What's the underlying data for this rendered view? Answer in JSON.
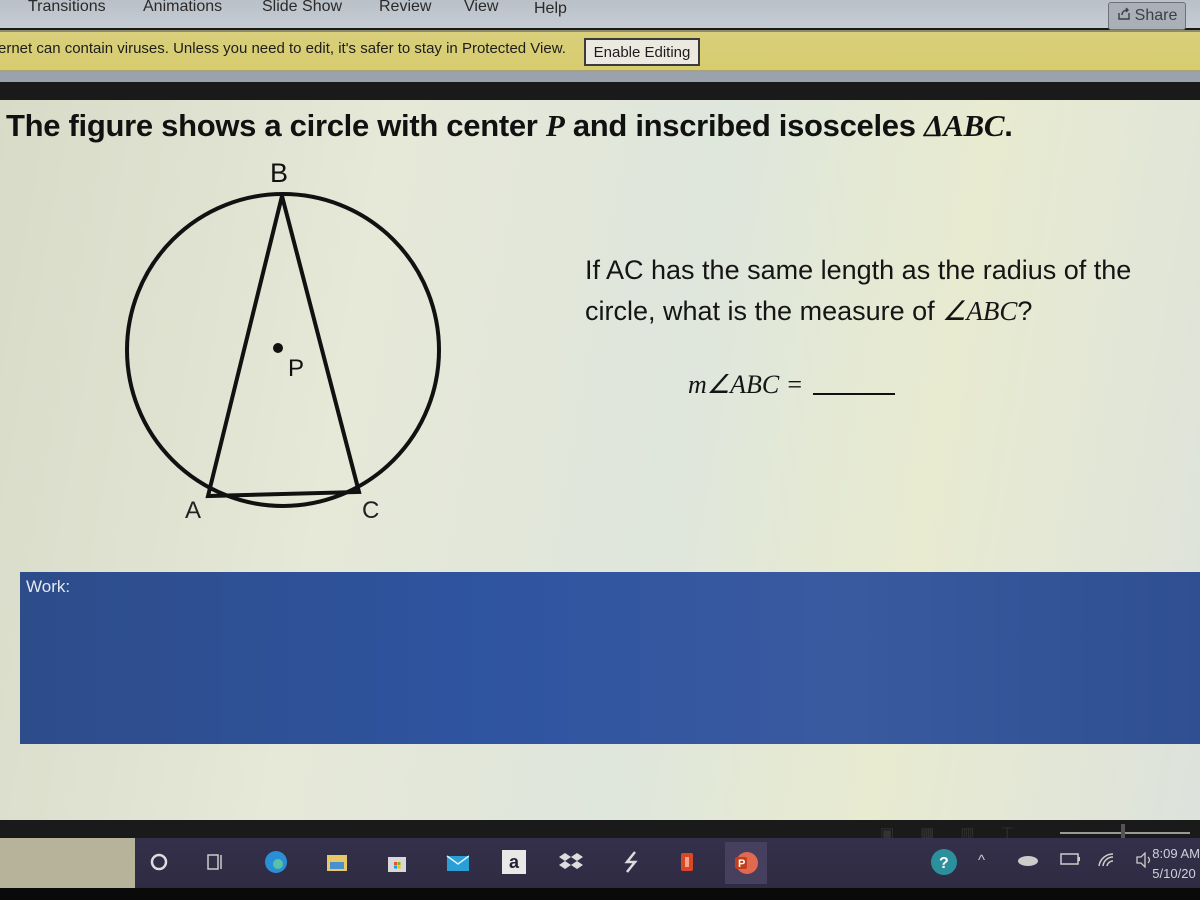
{
  "ribbon": {
    "tabs": [
      "Transitions",
      "Animations",
      "Slide Show",
      "Review",
      "View",
      "Help"
    ],
    "share_label": "Share",
    "share_icon": "share-icon"
  },
  "protected_view": {
    "message": "ernet can contain viruses. Unless you need to edit, it's safer to stay in Protected View.",
    "enable_button": "Enable Editing"
  },
  "slide": {
    "title_prefix": "The figure shows a circle with center ",
    "title_var": "P",
    "title_mid": " and inscribed isosceles ",
    "title_triangle": "ΔABC",
    "title_end": ".",
    "figure": {
      "labels": {
        "A": "A",
        "B": "B",
        "C": "C",
        "P": "P"
      }
    },
    "question_line1": "If AC has the same length as the radius of the",
    "question_line2_prefix": "circle, what is the measure of ",
    "question_angle": "∠ABC",
    "question_end": "?",
    "answer_label": "m∠ABC =",
    "work_label": "Work:"
  },
  "status_bar": {
    "view_icons": [
      "normal-view-icon",
      "slide-sorter-icon",
      "reading-view-icon",
      "slide-show-icon"
    ],
    "zoom_minus": "-"
  },
  "taskbar": {
    "apps": [
      "cortana",
      "task-view",
      "edge",
      "file-explorer",
      "store",
      "mail",
      "amazon",
      "dropbox",
      "app-lightning",
      "office",
      "powerpoint"
    ],
    "amazon_glyph": "a",
    "powerpoint_glyph": "P",
    "tray": [
      "help-icon",
      "chevron-up-icon",
      "onedrive-icon",
      "battery-icon",
      "wifi-icon",
      "volume-icon"
    ],
    "time": "8:09 AM",
    "date": "5/10/20"
  }
}
